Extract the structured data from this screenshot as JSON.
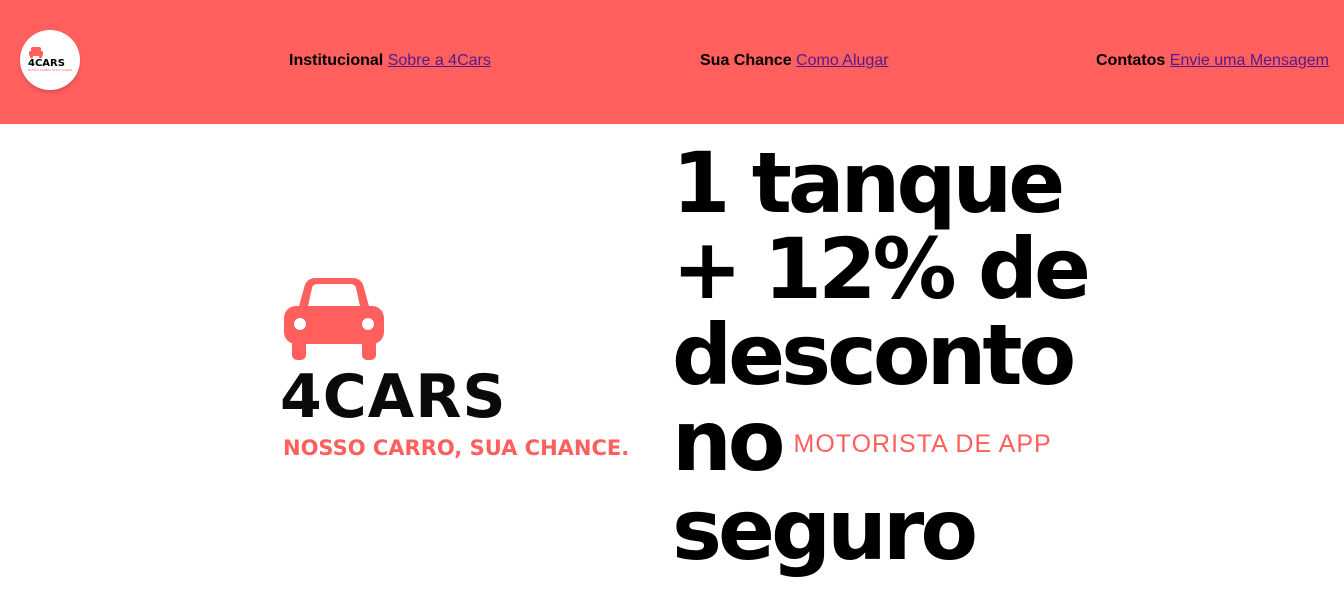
{
  "header": {
    "logo": {
      "icon": "car-icon",
      "name": "4CARS",
      "tagline": "NOSSO CARRO, SUA CHANCE."
    },
    "nav": [
      {
        "label": "Institucional",
        "link": "Sobre a 4Cars"
      },
      {
        "label": "Sua Chance",
        "link": "Como Alugar"
      },
      {
        "label": "Contatos",
        "link": "Envie uma Mensagem"
      }
    ]
  },
  "brand": {
    "icon": "car-icon",
    "name": "4CARS",
    "tagline": "NOSSO CARRO, SUA CHANCE."
  },
  "headline": {
    "line1": "1 tanque",
    "line2": "+ 12% de",
    "line3": "desconto",
    "line4": "no",
    "line5": "seguro",
    "subhead": "MOTORISTA DE APP"
  },
  "colors": {
    "accent": "#ff5f5d",
    "link": "#551a8b",
    "text": "#000000"
  }
}
